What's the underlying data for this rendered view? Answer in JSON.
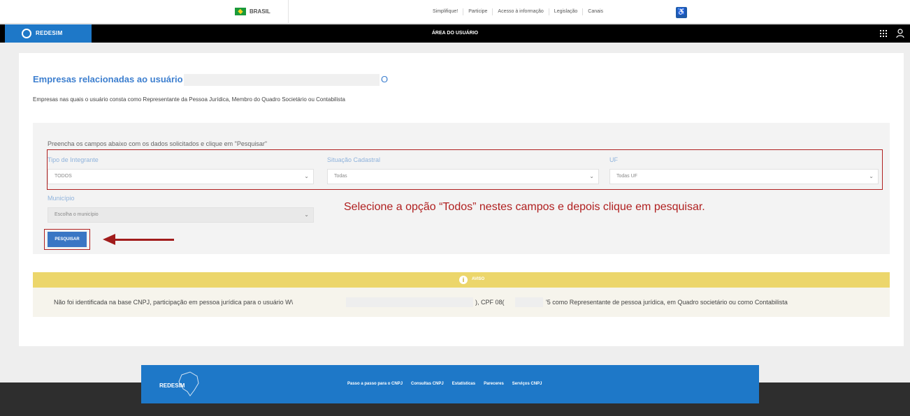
{
  "gov_bar": {
    "country": "BRASIL",
    "links": [
      "Simplifique!",
      "Participe",
      "Acesso à informação",
      "Legislação",
      "Canais"
    ],
    "accessibility_glyph": "♿"
  },
  "header": {
    "logo_text": "REDESIM",
    "area_title": "ÁREA DO USUÁRIO"
  },
  "page": {
    "title": "Empresas relacionadas ao usuário - W\\",
    "title_suffix": "O",
    "subtitle": "Empresas nas quais o usuário consta como Representante da Pessoa Jurídica, Membro do Quadro Societário ou Contabilista"
  },
  "filters": {
    "hint": "Preencha os campos abaixo com os dados solicitados e clique em \"Pesquisar\"",
    "tipo_label": "Tipo de Integrante",
    "tipo_value": "TODOS",
    "situacao_label": "Situação Cadastral",
    "situacao_value": "Todas",
    "uf_label": "UF",
    "uf_value": "Todas UF",
    "municipio_label": "Município",
    "municipio_value": "Escolha o município",
    "search_label": "PESQUISAR",
    "annotation": "Selecione a opção “Todos” nestes campos e depois clique em pesquisar."
  },
  "notice": {
    "icon_glyph": "i",
    "title": "AVISO",
    "text_part1": "Não foi identificada na base CNPJ, participação em pessoa jurídica para o usuário W\\",
    "text_part2": "), CPF 08(",
    "text_part3": "'5 como Representante de pessoa jurídica, em Quadro societário ou como Contabilista"
  },
  "footer": {
    "logo_text": "REDESIM",
    "links": [
      "Passo a passo para o CNPJ",
      "Consultas CNPJ",
      "Estatísticas",
      "Pareceres",
      "Serviços CNPJ"
    ]
  },
  "colors": {
    "brand_blue": "#1e78c8",
    "annotation_red": "#b02020",
    "notice_yellow": "#ecd66b"
  }
}
